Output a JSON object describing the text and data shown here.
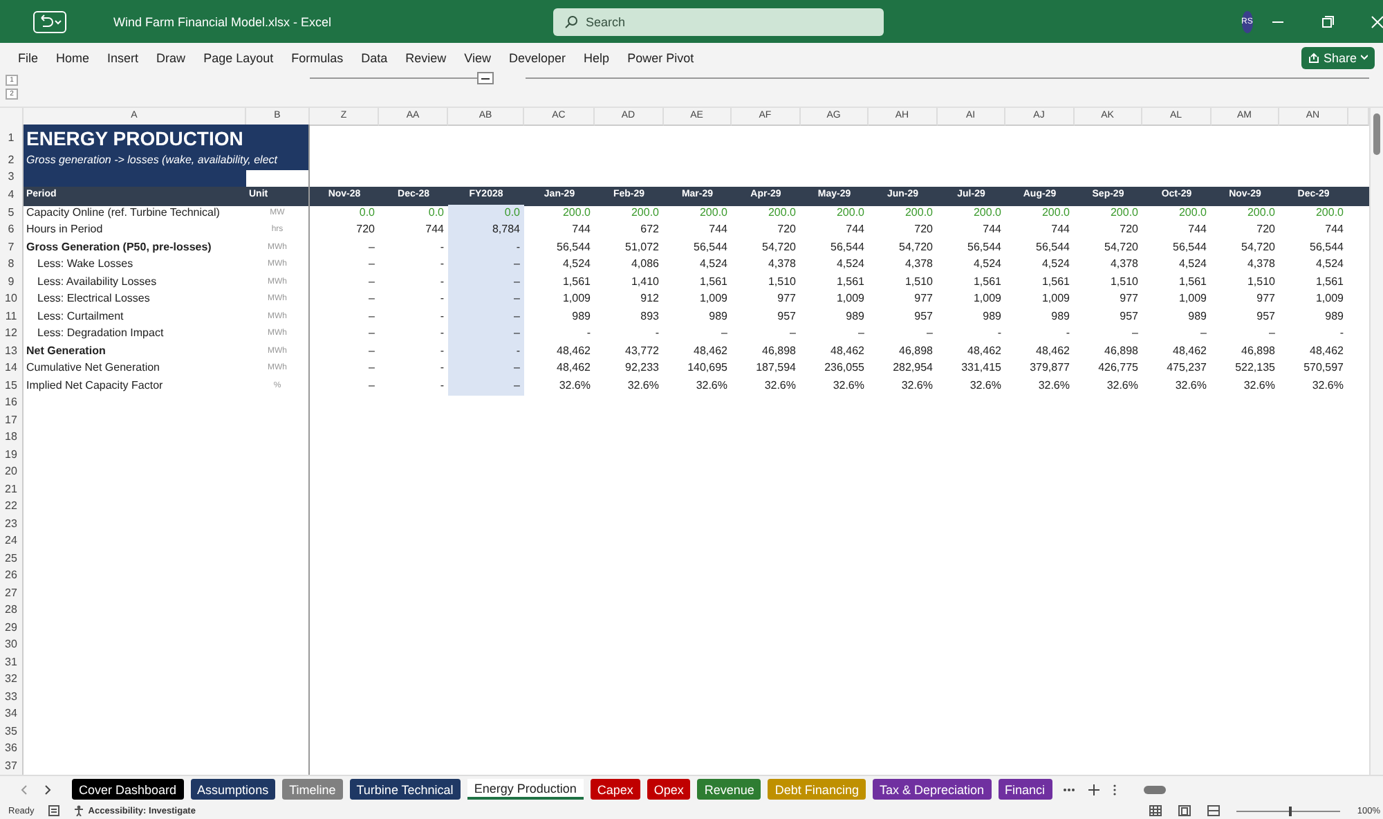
{
  "window": {
    "title": "Wind Farm Financial Model.xlsx  -  Excel",
    "search_placeholder": "Search",
    "avatar": "RS"
  },
  "menu": [
    "File",
    "Home",
    "Insert",
    "Draw",
    "Page Layout",
    "Formulas",
    "Data",
    "Review",
    "View",
    "Developer",
    "Help",
    "Power Pivot"
  ],
  "share_button": "Share",
  "outline_levels": [
    "1",
    "2"
  ],
  "fixed_columns": [
    "A",
    "B"
  ],
  "columns": [
    {
      "letter": "Z",
      "period": "Nov-28",
      "kind": "month"
    },
    {
      "letter": "AA",
      "period": "Dec-28",
      "kind": "month"
    },
    {
      "letter": "AB",
      "period": "FY2028",
      "kind": "annual"
    },
    {
      "letter": "AC",
      "period": "Jan-29",
      "kind": "month"
    },
    {
      "letter": "AD",
      "period": "Feb-29",
      "kind": "month"
    },
    {
      "letter": "AE",
      "period": "Mar-29",
      "kind": "month"
    },
    {
      "letter": "AF",
      "period": "Apr-29",
      "kind": "month"
    },
    {
      "letter": "AG",
      "period": "May-29",
      "kind": "month"
    },
    {
      "letter": "AH",
      "period": "Jun-29",
      "kind": "month"
    },
    {
      "letter": "AI",
      "period": "Jul-29",
      "kind": "month"
    },
    {
      "letter": "AJ",
      "period": "Aug-29",
      "kind": "month"
    },
    {
      "letter": "AK",
      "period": "Sep-29",
      "kind": "month"
    },
    {
      "letter": "AL",
      "period": "Oct-29",
      "kind": "month"
    },
    {
      "letter": "AM",
      "period": "Nov-29",
      "kind": "month"
    },
    {
      "letter": "AN",
      "period": "Dec-29",
      "kind": "month"
    }
  ],
  "sheet": {
    "title": {
      "row": "1",
      "text": "ENERGY PRODUCTION"
    },
    "subtitle": {
      "row": "2",
      "text": "Gross generation -> losses (wake, availability, elect"
    },
    "spacer_row": "3",
    "header": {
      "row": "4",
      "label": "Period",
      "unit": "Unit"
    },
    "rows": [
      {
        "row": "5",
        "label": "Capacity Online (ref. Turbine Technical)",
        "unit": "MW",
        "kind": "line",
        "input": true,
        "values": [
          "0.0",
          "0.0",
          "0.0",
          "200.0",
          "200.0",
          "200.0",
          "200.0",
          "200.0",
          "200.0",
          "200.0",
          "200.0",
          "200.0",
          "200.0",
          "200.0",
          "200.0"
        ]
      },
      {
        "row": "6",
        "label": "Hours in Period",
        "unit": "hrs",
        "kind": "line",
        "input": false,
        "values": [
          "720",
          "744",
          "8,784",
          "744",
          "672",
          "744",
          "720",
          "744",
          "720",
          "744",
          "744",
          "720",
          "744",
          "720",
          "744"
        ]
      },
      {
        "row": "7",
        "label": "Gross Generation (P50, pre-losses)",
        "unit": "MWh",
        "kind": "subtotal",
        "input": false,
        "values": [
          "–",
          "-",
          "-",
          "56,544",
          "51,072",
          "56,544",
          "54,720",
          "56,544",
          "54,720",
          "56,544",
          "56,544",
          "54,720",
          "56,544",
          "54,720",
          "56,544"
        ]
      },
      {
        "row": "8",
        "label": "Less: Wake Losses",
        "unit": "MWh",
        "kind": "loss",
        "input": false,
        "values": [
          "–",
          "-",
          "–",
          "4,524",
          "4,086",
          "4,524",
          "4,378",
          "4,524",
          "4,378",
          "4,524",
          "4,524",
          "4,378",
          "4,524",
          "4,378",
          "4,524"
        ]
      },
      {
        "row": "9",
        "label": "Less: Availability Losses",
        "unit": "MWh",
        "kind": "loss",
        "input": false,
        "values": [
          "–",
          "-",
          "–",
          "1,561",
          "1,410",
          "1,561",
          "1,510",
          "1,561",
          "1,510",
          "1,561",
          "1,561",
          "1,510",
          "1,561",
          "1,510",
          "1,561"
        ]
      },
      {
        "row": "10",
        "label": "Less: Electrical Losses",
        "unit": "MWh",
        "kind": "loss",
        "input": false,
        "values": [
          "–",
          "-",
          "–",
          "1,009",
          "912",
          "1,009",
          "977",
          "1,009",
          "977",
          "1,009",
          "1,009",
          "977",
          "1,009",
          "977",
          "1,009"
        ]
      },
      {
        "row": "11",
        "label": "Less: Curtailment",
        "unit": "MWh",
        "kind": "loss",
        "input": false,
        "values": [
          "–",
          "-",
          "–",
          "989",
          "893",
          "989",
          "957",
          "989",
          "957",
          "989",
          "989",
          "957",
          "989",
          "957",
          "989"
        ]
      },
      {
        "row": "12",
        "label": "Less: Degradation Impact",
        "unit": "MWh",
        "kind": "loss",
        "input": false,
        "values": [
          "–",
          "-",
          "–",
          "-",
          "-",
          "–",
          "–",
          "–",
          "–",
          "-",
          "-",
          "–",
          "–",
          "–",
          "-"
        ]
      },
      {
        "row": "13",
        "label": "Net Generation",
        "unit": "MWh",
        "kind": "subtotal",
        "input": false,
        "values": [
          "–",
          "-",
          "-",
          "48,462",
          "43,772",
          "48,462",
          "46,898",
          "48,462",
          "46,898",
          "48,462",
          "48,462",
          "46,898",
          "48,462",
          "46,898",
          "48,462"
        ]
      },
      {
        "row": "14",
        "label": "Cumulative Net Generation",
        "unit": "MWh",
        "kind": "line",
        "input": false,
        "values": [
          "–",
          "-",
          "–",
          "48,462",
          "92,233",
          "140,695",
          "187,594",
          "236,055",
          "282,954",
          "331,415",
          "379,877",
          "426,775",
          "475,237",
          "522,135",
          "570,597"
        ]
      },
      {
        "row": "15",
        "label": "Implied Net Capacity Factor",
        "unit": "%",
        "kind": "line",
        "input": false,
        "values": [
          "–",
          "-",
          "–",
          "32.6%",
          "32.6%",
          "32.6%",
          "32.6%",
          "32.6%",
          "32.6%",
          "32.6%",
          "32.6%",
          "32.6%",
          "32.6%",
          "32.6%",
          "32.6%"
        ]
      }
    ],
    "empty_rows": [
      "16",
      "17",
      "18",
      "19",
      "20",
      "21",
      "22",
      "23",
      "24",
      "25",
      "26",
      "27",
      "28",
      "29",
      "30",
      "31",
      "32",
      "33",
      "34",
      "35",
      "36",
      "37"
    ]
  },
  "tabs": [
    {
      "label": "Cover Dashboard",
      "color": "#000000",
      "selected": false
    },
    {
      "label": "Assumptions",
      "color": "#1f3864",
      "selected": false
    },
    {
      "label": "Timeline",
      "color": "#808080",
      "selected": false
    },
    {
      "label": "Turbine Technical",
      "color": "#1f3864",
      "selected": false
    },
    {
      "label": "Energy Production",
      "color": "#1f7244",
      "selected": true
    },
    {
      "label": "Capex",
      "color": "#c00000",
      "selected": false
    },
    {
      "label": "Opex",
      "color": "#c00000",
      "selected": false
    },
    {
      "label": "Revenue",
      "color": "#2e7d32",
      "selected": false
    },
    {
      "label": "Debt Financing",
      "color": "#bf9000",
      "selected": false
    },
    {
      "label": "Tax & Depreciation",
      "color": "#7030a0",
      "selected": false
    },
    {
      "label": "Financi",
      "color": "#7030a0",
      "selected": false
    }
  ],
  "status_bar": {
    "status": "Ready",
    "accessibility": "Accessibility: Investigate",
    "zoom": "100%",
    "zoom_slider": {
      "level": 0.5
    }
  }
}
